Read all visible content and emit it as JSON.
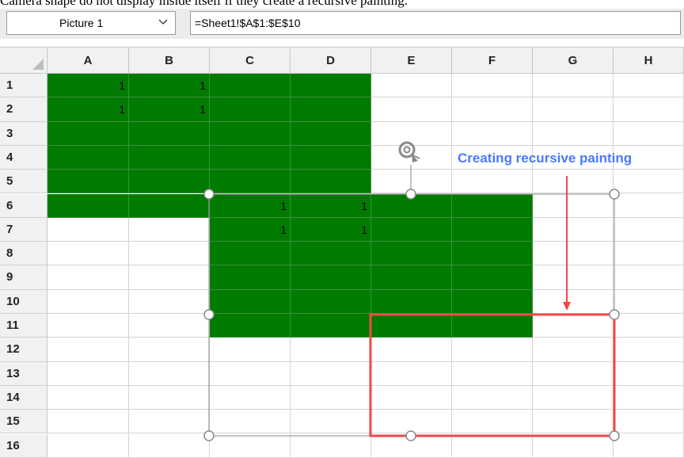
{
  "caption": "Camera shape do not display inside itself if they create a recursive painting.",
  "formula_bar": {
    "name_box": "Picture 1",
    "formula": "=Sheet1!$A$1:$E$10"
  },
  "icons": [
    "chevron-down-icon",
    "select-all-icon",
    "rotate-handle-icon",
    "resize-handle-icon",
    "arrow-down-icon"
  ],
  "colors": {
    "fill": "#007b00",
    "annotation": "#4a78ff",
    "highlight": "#f04848"
  },
  "columns": [
    "A",
    "B",
    "C",
    "D",
    "E",
    "F",
    "G",
    "H"
  ],
  "rows": [
    "1",
    "2",
    "3",
    "4",
    "5",
    "6",
    "7",
    "8",
    "9",
    "10",
    "11",
    "12",
    "13",
    "14",
    "15",
    "16"
  ],
  "cells": {
    "A1": "1",
    "B1": "1",
    "A2": "1",
    "B2": "1",
    "C6": "1",
    "D6": "1",
    "C7": "1",
    "D7": "1"
  },
  "annotation": "Creating recursive painting"
}
